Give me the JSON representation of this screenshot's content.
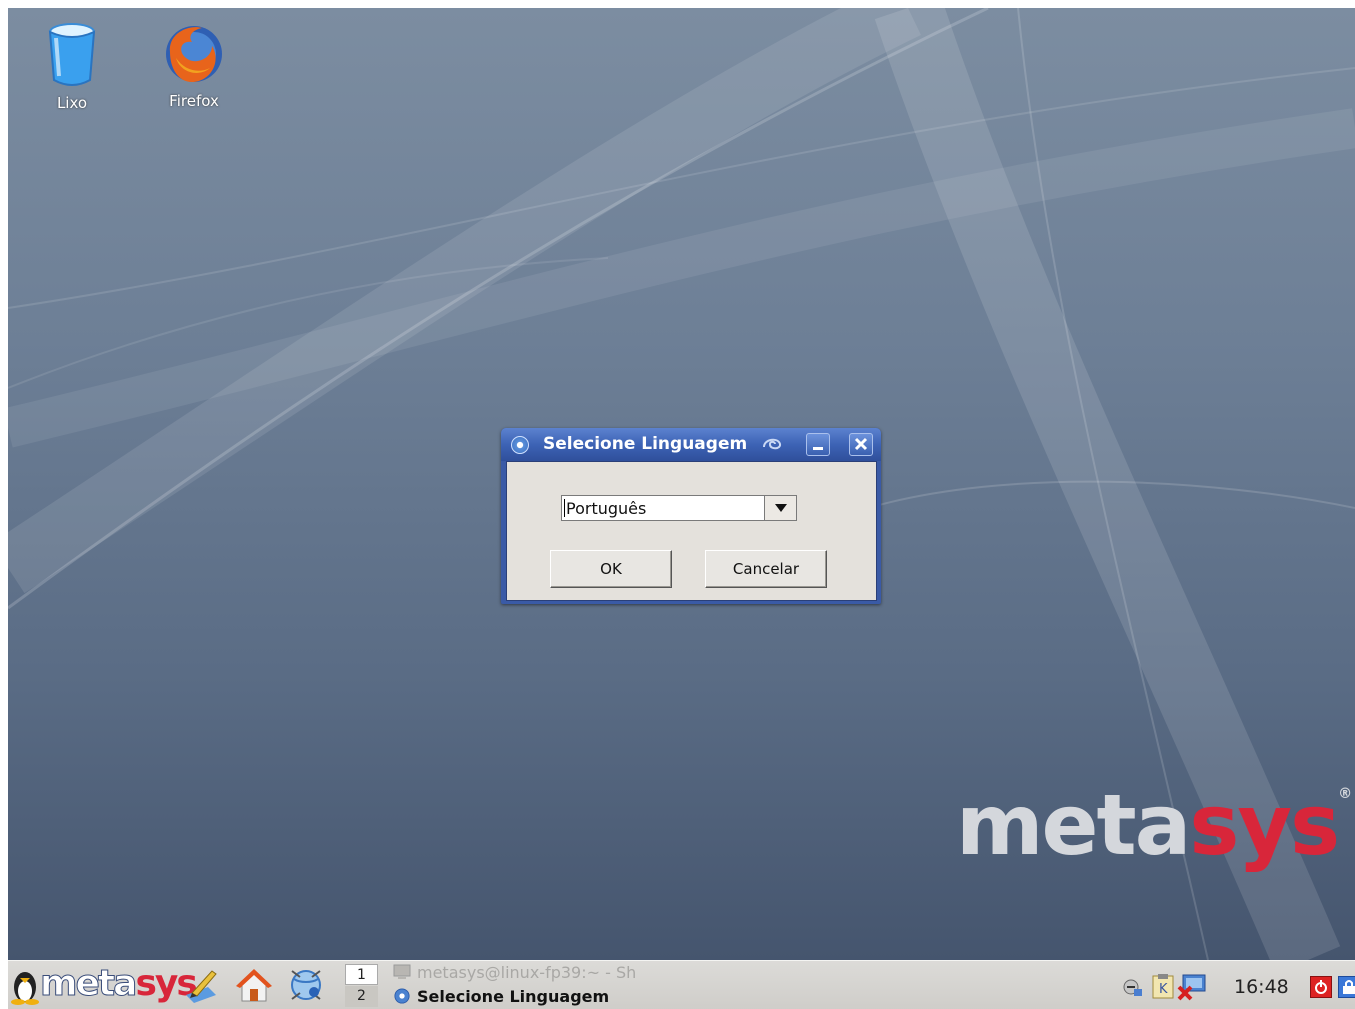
{
  "desktop": {
    "icons": [
      {
        "label": "Lixo",
        "icon": "trash-icon"
      },
      {
        "label": "Firefox",
        "icon": "firefox-icon"
      }
    ],
    "brand": {
      "meta": "meta",
      "sys": "sys",
      "reg": "®"
    }
  },
  "dialog": {
    "title": "Selecione Linguagem",
    "language_value": "Português",
    "ok_label": "OK",
    "cancel_label": "Cancelar"
  },
  "taskbar": {
    "start_brand_meta": "meta",
    "start_brand_sys": "sys",
    "pager": [
      "1",
      "2"
    ],
    "tasks": [
      {
        "label": "metasys@linux-fp39:~ - Sh",
        "active": false
      },
      {
        "label": "Selecione Linguagem",
        "active": true
      }
    ],
    "clock": "16:48"
  },
  "colors": {
    "desktop_top": "#7c8da1",
    "desktop_bottom": "#45556e",
    "titlebar": "#3d63b5",
    "brand_red": "#d8263a",
    "dialog_body": "#e4e1dc",
    "taskbar": "#d5d4d0"
  }
}
